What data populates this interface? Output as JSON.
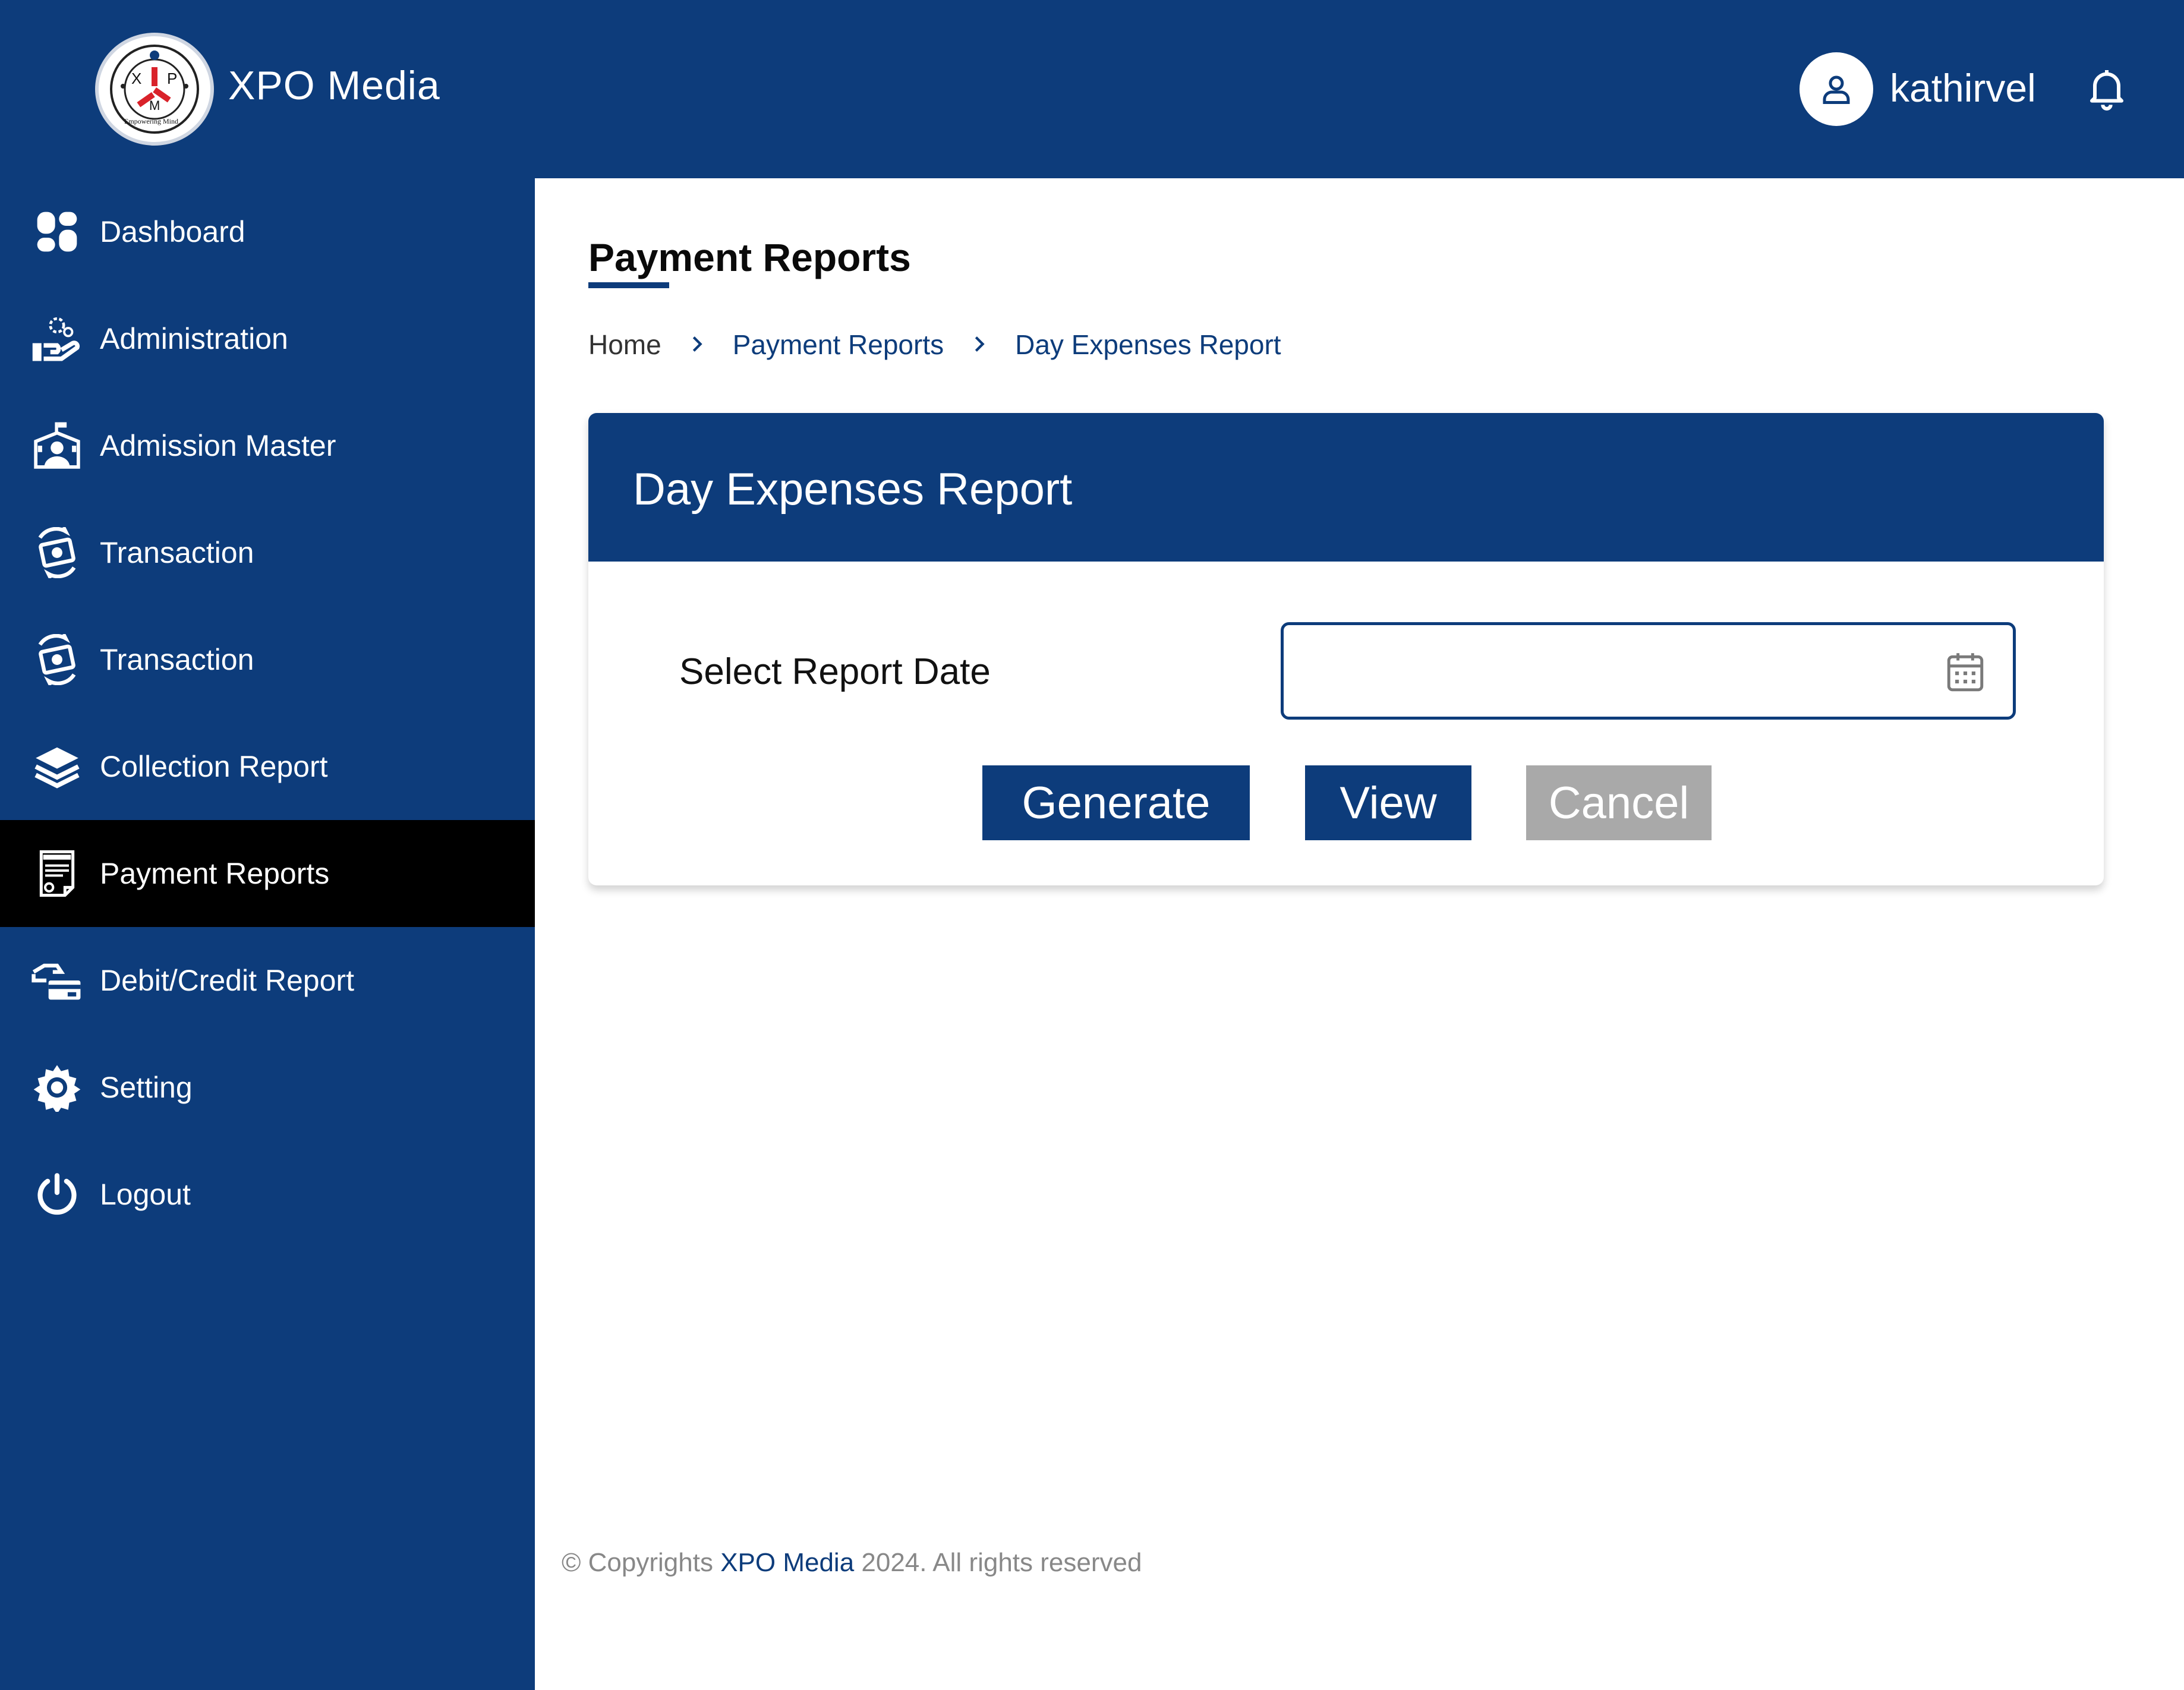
{
  "header": {
    "brand": "XPO Media",
    "username": "kathirvel",
    "logo_letters": {
      "x": "X",
      "p": "P",
      "m": "M"
    },
    "logo_motto": "Empowering Mind"
  },
  "sidebar": {
    "items": [
      {
        "label": "Dashboard",
        "icon": "dashboard-icon"
      },
      {
        "label": "Administration",
        "icon": "admin-gear-hand-icon"
      },
      {
        "label": "Admission Master",
        "icon": "admission-icon"
      },
      {
        "label": "Transaction",
        "icon": "money-transfer-icon"
      },
      {
        "label": "Transaction",
        "icon": "money-transfer-icon"
      },
      {
        "label": "Collection Report",
        "icon": "layers-icon"
      },
      {
        "label": "Payment Reports",
        "icon": "invoice-icon",
        "active": true
      },
      {
        "label": "Debit/Credit Report",
        "icon": "card-payment-icon"
      },
      {
        "label": "Setting",
        "icon": "gear-icon"
      },
      {
        "label": "Logout",
        "icon": "power-icon"
      }
    ]
  },
  "main": {
    "page_title": "Payment Reports",
    "breadcrumb": [
      "Home",
      "Payment Reports",
      "Day Expenses Report"
    ],
    "card": {
      "title": "Day Expenses Report",
      "field_label": "Select Report Date",
      "date_value": "",
      "buttons": {
        "generate": "Generate",
        "view": "View",
        "cancel": "Cancel"
      }
    }
  },
  "footer": {
    "prefix": "© Copyrights ",
    "brand": "XPO Media",
    "suffix": " 2024. All rights reserved"
  },
  "colors": {
    "primary": "#0d3c7b",
    "active_nav": "#000000",
    "cancel": "#a9a9a9"
  }
}
